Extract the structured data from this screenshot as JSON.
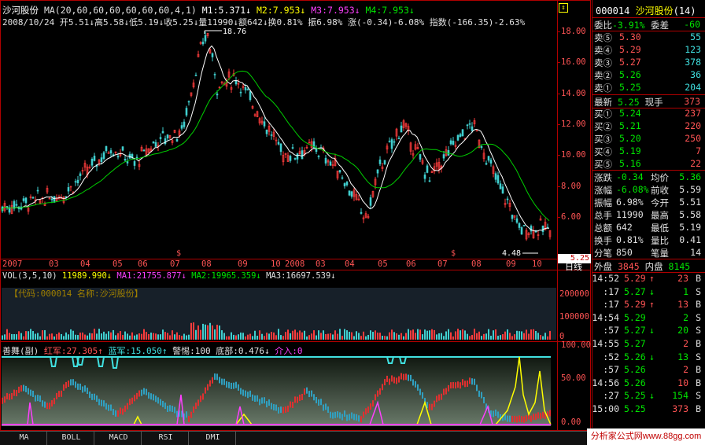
{
  "header": {
    "stock_name": "沙河股份",
    "ma_params": "MA(20,60,60,60,60,60,60,4,1)",
    "m1": "M1:5.371↓",
    "m2": "M2:7.953↓",
    "m3": "M3:7.953↓",
    "m4": "M4:7.953↓",
    "line2_date": "2008/10/24",
    "line2_ohlc": "开5.51↓高5.58↓低5.19↓收5.25↓量11990↓额642↓换0.81%",
    "line2_amp": "振6.98%",
    "line2_chg": "涨(-0.34)-6.08%",
    "line2_idx": "指数(-166.35)-2.63%"
  },
  "price_axis": [
    "18.00",
    "16.00",
    "14.00",
    "12.00",
    "10.00",
    "8.00",
    "6.00"
  ],
  "price_high_label": "18.76",
  "price_low_label": "4.48",
  "current_price_tag": "5.25",
  "date_axis": [
    "2007",
    "03",
    "04",
    "05",
    "06",
    "07",
    "08",
    "09",
    "10",
    "2008",
    "03",
    "04",
    "05",
    "06",
    "07",
    "08",
    "09",
    "10"
  ],
  "markers": [
    "$",
    "$"
  ],
  "period_label": "日线",
  "vol_header": {
    "params": "VOL(3,5,10)",
    "v": "11989.990↓",
    "ma1": "MA1:21755.877↓",
    "ma2": "MA2:19965.359↓",
    "ma3": "MA3:16697.539↓"
  },
  "vol_axis": [
    "200000",
    "100000",
    "0"
  ],
  "vol_watermark": "【代码:000014 名称:沙河股份】",
  "ind_header": {
    "name": "善舞(副)",
    "red": "红军:27.305↑",
    "blue": "蓝军:15.050↑",
    "warn": "警惕:100",
    "bottom": "底部:0.476↓",
    "enter": "介入:0"
  },
  "ind_axis": [
    "100.00",
    "50.00",
    "0.00"
  ],
  "tabs": [
    "MA",
    "BOLL",
    "MACD",
    "RSI",
    "DMI"
  ],
  "quote": {
    "code": "000014",
    "name": "沙河股份",
    "num": "(14)",
    "ratio_label": "委比",
    "ratio": "-3.91%",
    "diff_label": "委差",
    "diff": "-60",
    "asks": [
      {
        "l": "卖⑤",
        "p": "5.30",
        "v": "55"
      },
      {
        "l": "卖④",
        "p": "5.29",
        "v": "123"
      },
      {
        "l": "卖③",
        "p": "5.27",
        "v": "378"
      },
      {
        "l": "卖②",
        "p": "5.26",
        "v": "36"
      },
      {
        "l": "卖①",
        "p": "5.25",
        "v": "204"
      }
    ],
    "last_label": "最新",
    "last": "5.25",
    "hand_label": "现手",
    "hand": "373",
    "bids": [
      {
        "l": "买①",
        "p": "5.24",
        "v": "237"
      },
      {
        "l": "买②",
        "p": "5.21",
        "v": "220"
      },
      {
        "l": "买③",
        "p": "5.20",
        "v": "250"
      },
      {
        "l": "买④",
        "p": "5.19",
        "v": "7"
      },
      {
        "l": "买⑤",
        "p": "5.16",
        "v": "22"
      }
    ],
    "stats": [
      {
        "l1": "涨跌",
        "v1": "-0.34",
        "l2": "均价",
        "v2": "5.36"
      },
      {
        "l1": "涨幅",
        "v1": "-6.08%",
        "l2": "前收",
        "v2": "5.59"
      },
      {
        "l1": "振幅",
        "v1": "6.98%",
        "l2": "今开",
        "v2": "5.51"
      },
      {
        "l1": "总手",
        "v1": "11990",
        "l2": "最高",
        "v2": "5.58"
      },
      {
        "l1": "总额",
        "v1": "642",
        "l2": "最低",
        "v2": "5.19"
      },
      {
        "l1": "换手",
        "v1": "0.81%",
        "l2": "量比",
        "v2": "0.41"
      },
      {
        "l1": "分笔",
        "v1": "850",
        "l2": "笔量",
        "v2": "14"
      }
    ],
    "outer_label": "外盘",
    "outer": "3845",
    "inner_label": "内盘",
    "inner": "8145",
    "ticks": [
      {
        "t": "14:52",
        "p": "5.29",
        "a": "↑",
        "v": "23",
        "s": "B"
      },
      {
        "t": ":17",
        "p": "5.27",
        "a": "↓",
        "v": "1",
        "s": "S"
      },
      {
        "t": ":17",
        "p": "5.29",
        "a": "↑",
        "v": "13",
        "s": "B"
      },
      {
        "t": "14:54",
        "p": "5.29",
        "a": "",
        "v": "2",
        "s": "S"
      },
      {
        "t": ":57",
        "p": "5.27",
        "a": "↓",
        "v": "20",
        "s": "S"
      },
      {
        "t": "14:55",
        "p": "5.27",
        "a": "",
        "v": "2",
        "s": "B"
      },
      {
        "t": ":52",
        "p": "5.26",
        "a": "↓",
        "v": "13",
        "s": "S"
      },
      {
        "t": ":57",
        "p": "5.26",
        "a": "",
        "v": "2",
        "s": "B"
      },
      {
        "t": "14:56",
        "p": "5.26",
        "a": "",
        "v": "10",
        "s": "B"
      },
      {
        "t": ":27",
        "p": "5.25",
        "a": "↓",
        "v": "154",
        "s": "S"
      },
      {
        "t": "15:00",
        "p": "5.25",
        "a": "",
        "v": "373",
        "s": "B"
      }
    ]
  },
  "footer": "分析家公式网www.88gg.com"
}
